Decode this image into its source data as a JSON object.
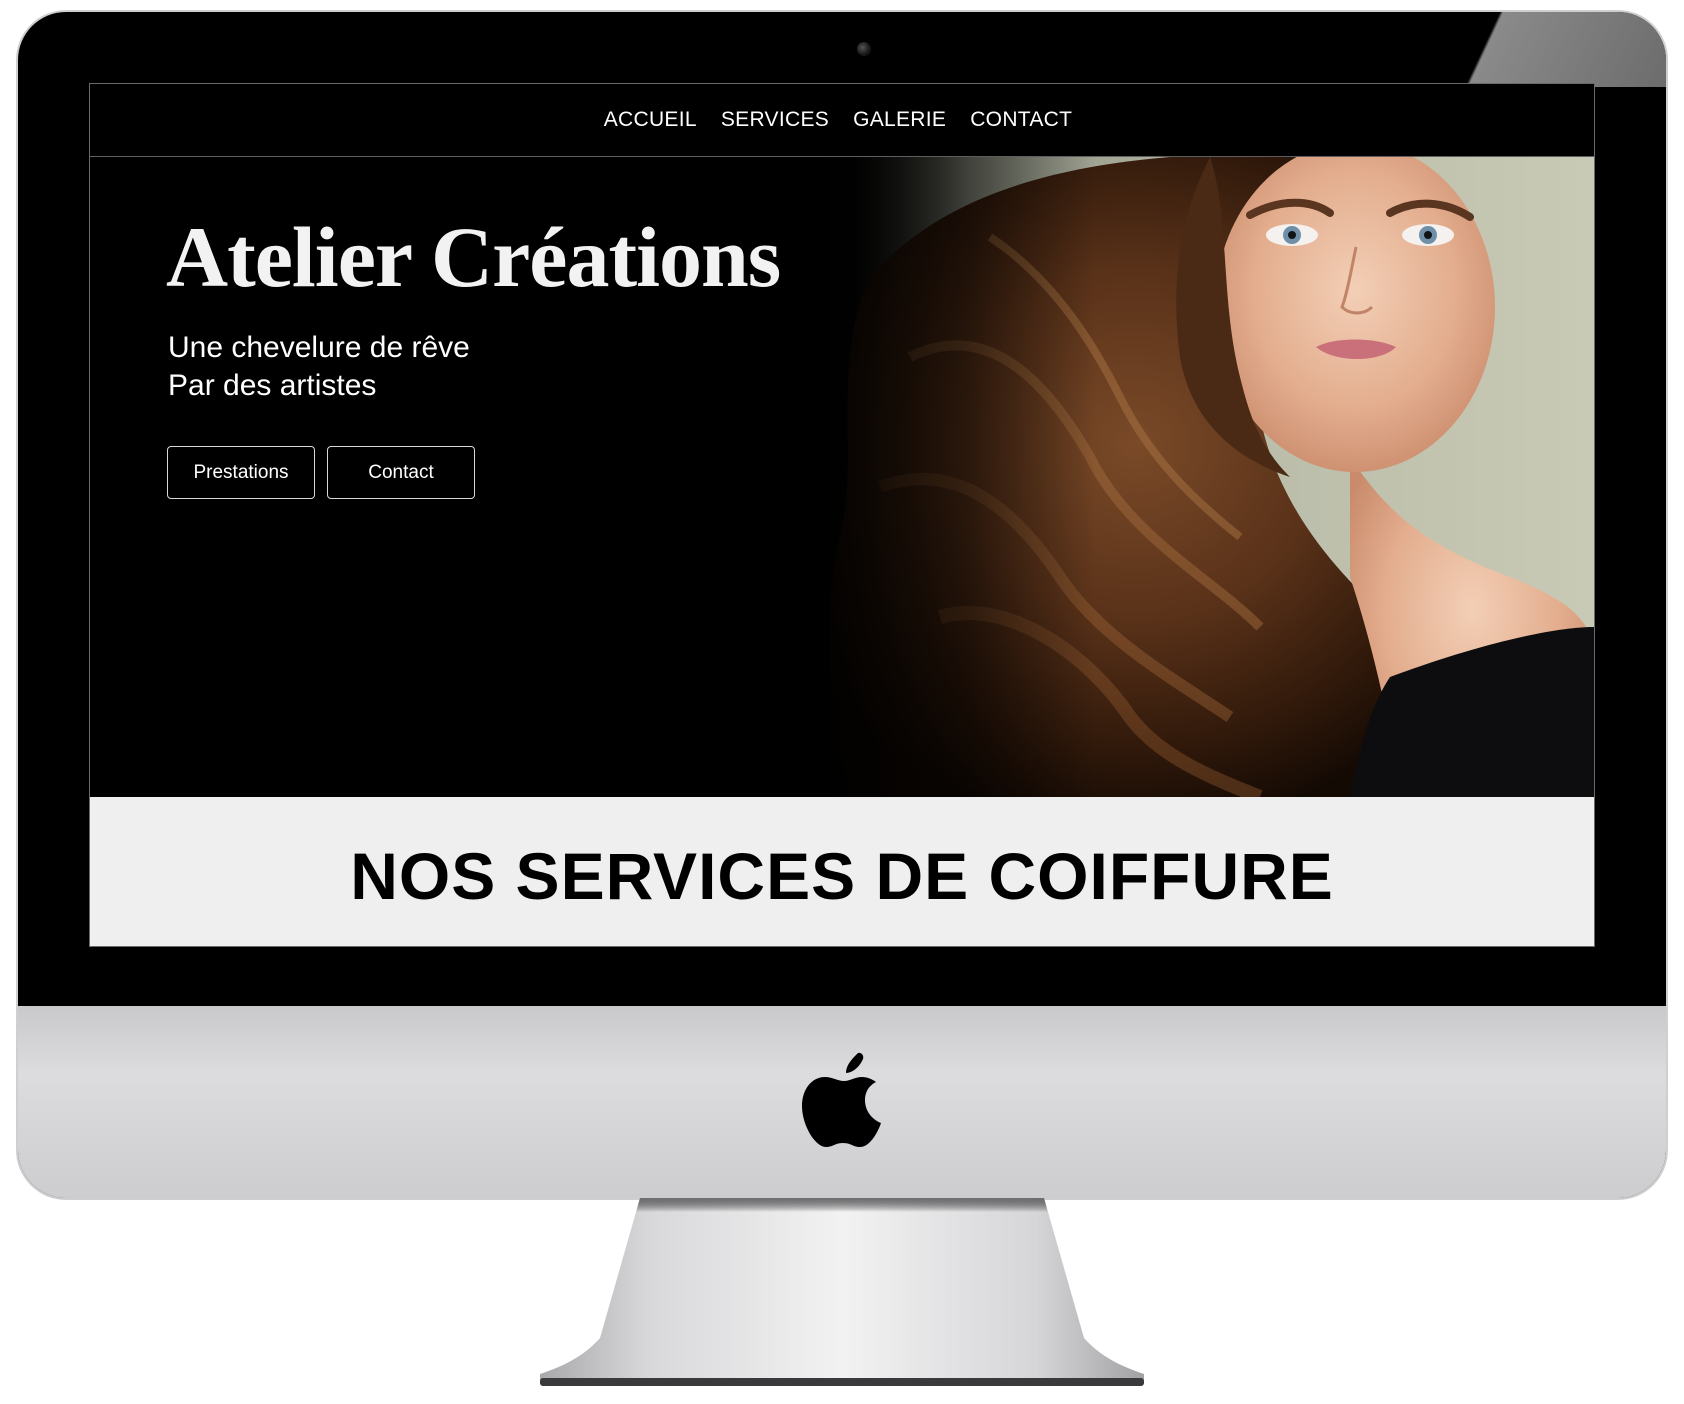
{
  "nav": {
    "items": [
      {
        "label": "ACCUEIL"
      },
      {
        "label": "SERVICES"
      },
      {
        "label": "GALERIE"
      },
      {
        "label": "CONTACT"
      }
    ]
  },
  "hero": {
    "title": "Atelier Créations",
    "subtitle_line1": "Une chevelure de rêve",
    "subtitle_line2": "Par des artistes",
    "buttons": {
      "prestations": "Prestations",
      "contact": "Contact"
    },
    "image": "woman-with-long-wavy-hair-portrait"
  },
  "services": {
    "heading": "NOS SERVICES DE COIFFURE"
  },
  "device": {
    "type": "imac",
    "logo": "apple-logo-icon"
  },
  "colors": {
    "background": "#000000",
    "text": "#ffffff",
    "band": "#efefef",
    "heading": "#000000"
  }
}
